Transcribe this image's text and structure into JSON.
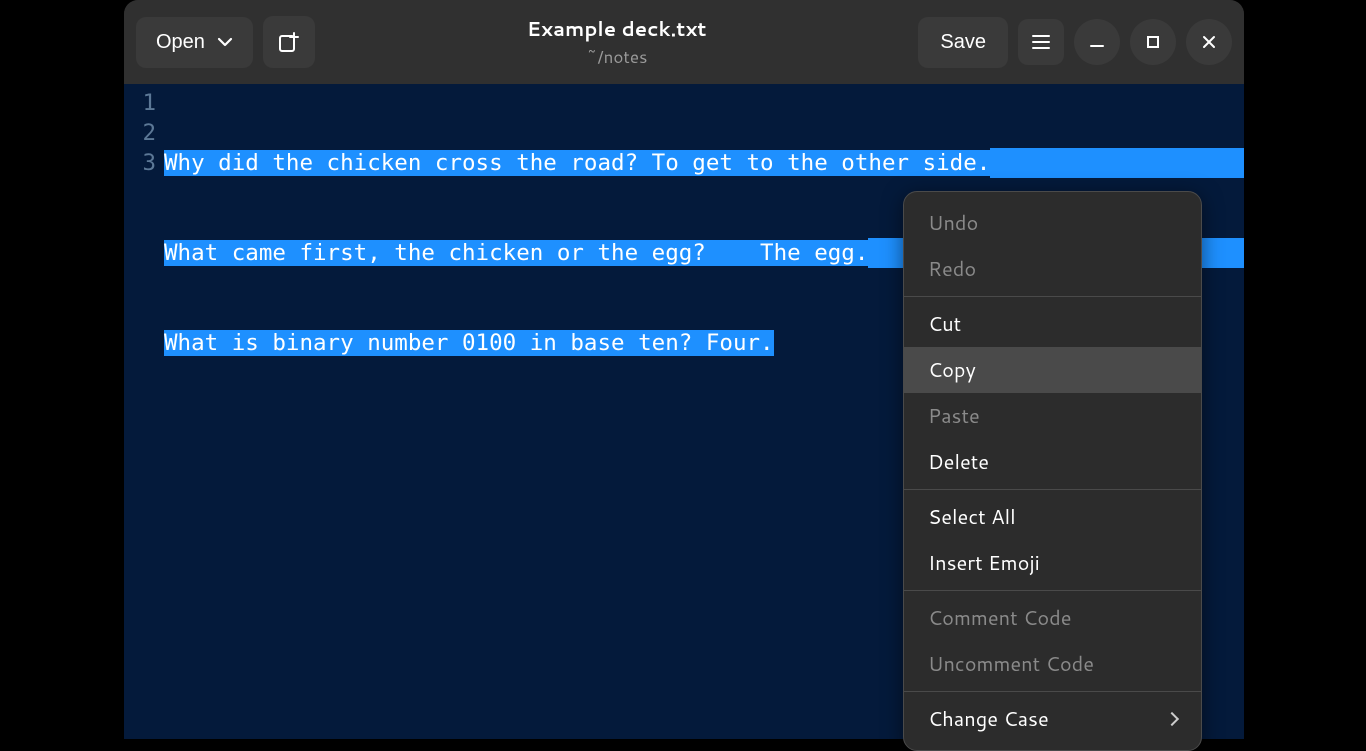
{
  "header": {
    "open_label": "Open",
    "save_label": "Save",
    "title": "Example deck.txt",
    "subtitle": "~/notes"
  },
  "editor": {
    "lines": [
      {
        "num": "1",
        "text": "Why did the chicken cross the road? To get to the other side."
      },
      {
        "num": "2",
        "text": "What came first, the chicken or the egg?    The egg."
      },
      {
        "num": "3",
        "text": "What is binary number 0100 in base ten? Four."
      }
    ]
  },
  "context_menu": {
    "undo": "Undo",
    "redo": "Redo",
    "cut": "Cut",
    "copy": "Copy",
    "paste": "Paste",
    "delete": "Delete",
    "select_all": "Select All",
    "insert_emoji": "Insert Emoji",
    "comment_code": "Comment Code",
    "uncomment_code": "Uncomment Code",
    "change_case": "Change Case"
  }
}
